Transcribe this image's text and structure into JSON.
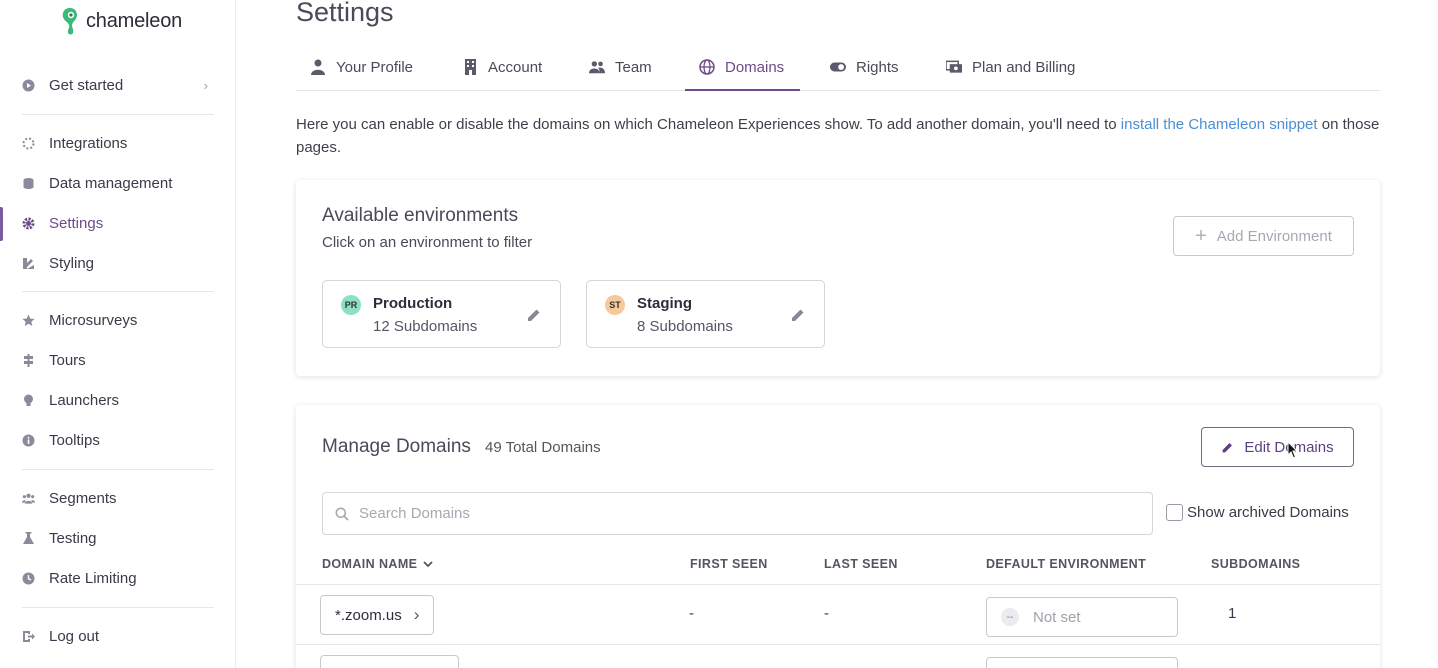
{
  "brand": {
    "name": "chameleon",
    "accent": "#6d4a8a",
    "logo_green": "#3cb878"
  },
  "sidebar": {
    "items": [
      {
        "label": "Get started",
        "icon": "play-circle-icon"
      },
      {
        "label": "Integrations",
        "icon": "integrations-icon"
      },
      {
        "label": "Data management",
        "icon": "database-icon"
      },
      {
        "label": "Settings",
        "icon": "gear-icon",
        "active": true
      },
      {
        "label": "Styling",
        "icon": "palette-icon"
      },
      {
        "label": "Microsurveys",
        "icon": "star-icon"
      },
      {
        "label": "Tours",
        "icon": "signpost-icon"
      },
      {
        "label": "Launchers",
        "icon": "bulb-icon"
      },
      {
        "label": "Tooltips",
        "icon": "info-bubble-icon"
      },
      {
        "label": "Segments",
        "icon": "users-icon"
      },
      {
        "label": "Testing",
        "icon": "flask-icon"
      },
      {
        "label": "Rate Limiting",
        "icon": "clock-icon"
      },
      {
        "label": "Log out",
        "icon": "logout-icon"
      }
    ]
  },
  "page": {
    "title": "Settings"
  },
  "tabs": [
    {
      "label": "Your Profile",
      "icon": "person-icon"
    },
    {
      "label": "Account",
      "icon": "building-icon"
    },
    {
      "label": "Team",
      "icon": "team-icon"
    },
    {
      "label": "Domains",
      "icon": "globe-icon",
      "active": true
    },
    {
      "label": "Rights",
      "icon": "toggle-icon"
    },
    {
      "label": "Plan and Billing",
      "icon": "billing-icon"
    }
  ],
  "intro": {
    "text_before": "Here you can enable or disable the domains on which Chameleon Experiences show. To add another domain, you'll need to ",
    "link": "install the Chameleon snippet",
    "text_after": " on those pages."
  },
  "environments": {
    "title": "Available environments",
    "subtitle": "Click on an environment to filter",
    "add_button": "Add Environment",
    "items": [
      {
        "badge": "PR",
        "name": "Production",
        "count": "12 Subdomains",
        "badge_color": "#8ee0c4"
      },
      {
        "badge": "ST",
        "name": "Staging",
        "count": "8 Subdomains",
        "badge_color": "#f7c99a"
      }
    ]
  },
  "manage": {
    "title": "Manage Domains",
    "total": "49 Total Domains",
    "edit_button": "Edit Domains",
    "search_placeholder": "Search Domains",
    "show_archived": "Show archived Domains",
    "columns": {
      "domain": "DOMAIN NAME",
      "first_seen": "FIRST SEEN",
      "last_seen": "LAST SEEN",
      "default_env": "DEFAULT ENVIRONMENT",
      "subdomains": "SUBDOMAINS"
    },
    "rows": [
      {
        "domain": "*.zoom.us",
        "first_seen": "-",
        "last_seen": "-",
        "env_badge": "--",
        "env": "Not set",
        "subdomains": "1"
      }
    ]
  }
}
